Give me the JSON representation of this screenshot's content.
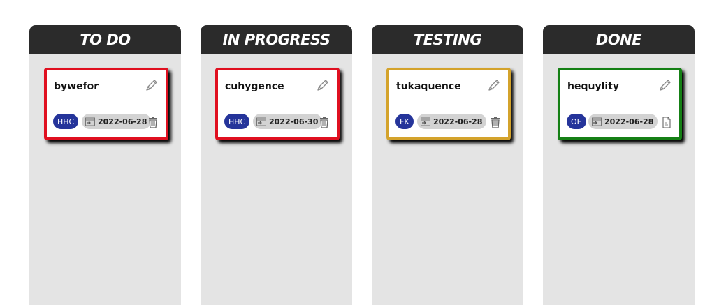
{
  "columns": [
    {
      "title": "TO DO",
      "card": {
        "title": "bywefor",
        "assignee": "HHC",
        "date": "2022-06-28",
        "action_icon": "trash-icon",
        "border_color": "#e01020"
      }
    },
    {
      "title": "IN PROGRESS",
      "card": {
        "title": "cuhygence",
        "assignee": "HHC",
        "date": "2022-06-30",
        "action_icon": "trash-icon",
        "border_color": "#e01020"
      }
    },
    {
      "title": "TESTING",
      "card": {
        "title": "tukaquence",
        "assignee": "FK",
        "date": "2022-06-28",
        "action_icon": "trash-icon",
        "border_color": "#d4a32c"
      }
    },
    {
      "title": "DONE",
      "card": {
        "title": "hequylity",
        "assignee": "OE",
        "date": "2022-06-28",
        "action_icon": "file-icon",
        "border_color": "#158015"
      }
    }
  ],
  "colors": {
    "header_bg": "#2b2b2b",
    "column_bg": "#e4e4e4",
    "assignee_badge": "#25349a"
  }
}
